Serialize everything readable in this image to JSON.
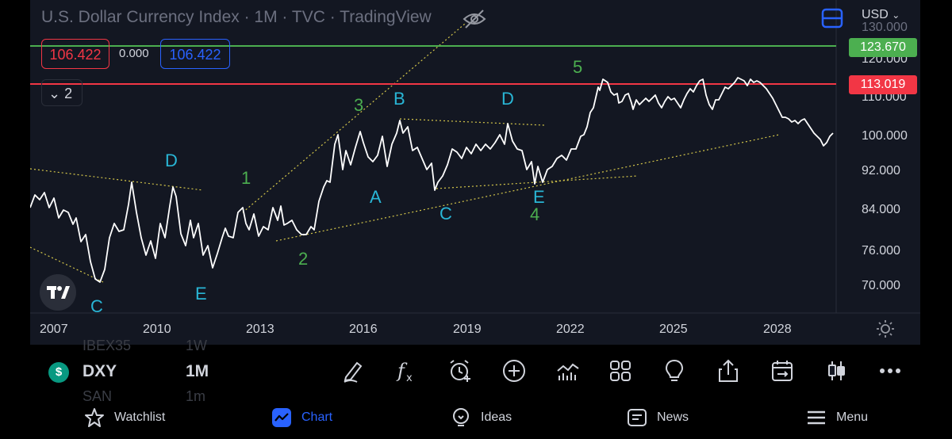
{
  "chart": {
    "title": "U.S. Dollar Currency Index · 1M · TVC · TradingView",
    "sell_price": "106.422",
    "spread": "0.000",
    "buy_price": "106.422",
    "collapse_count": "2",
    "currency": "USD",
    "price_scale": [
      "130.000",
      "120.000",
      "110.000",
      "100.000",
      "92.000",
      "84.000",
      "76.000",
      "70.000"
    ],
    "time_scale": [
      "2007",
      "2010",
      "2013",
      "2016",
      "2019",
      "2022",
      "2025",
      "2028"
    ],
    "price_tags": [
      {
        "label": "123.670",
        "color": "#4caf50"
      },
      {
        "label": "113.019",
        "color": "#f23645"
      }
    ],
    "wave_labels": [
      "1",
      "2",
      "3",
      "4",
      "5",
      "A",
      "B",
      "C",
      "D",
      "E",
      "C",
      "D",
      "E"
    ],
    "line_colors": {
      "price": "#ffffff",
      "green_level": "#4caf50",
      "red_level": "#f23645",
      "trendline": "#d4c64a"
    }
  },
  "toolbar": {
    "symbol_badge": "$",
    "symbol": "DXY",
    "interval": "1M",
    "ghost_above_symbol": "IBEX35",
    "ghost_above_interval": "1W",
    "ghost_below_symbol": "SAN",
    "ghost_below_interval": "1m",
    "tools": [
      "pen-icon",
      "function-icon",
      "alarm-icon",
      "plus-circle-icon",
      "indicator-icon",
      "grid-icon",
      "lightbulb-icon",
      "share-icon",
      "calendar-icon",
      "candles-icon",
      "more-icon"
    ]
  },
  "nav": {
    "items": [
      {
        "label": "Watchlist",
        "icon": "star-icon"
      },
      {
        "label": "Chart",
        "icon": "chart-icon"
      },
      {
        "label": "Ideas",
        "icon": "ideas-icon"
      },
      {
        "label": "News",
        "icon": "news-icon"
      },
      {
        "label": "Menu",
        "icon": "menu-icon"
      }
    ],
    "active": "Chart"
  }
}
